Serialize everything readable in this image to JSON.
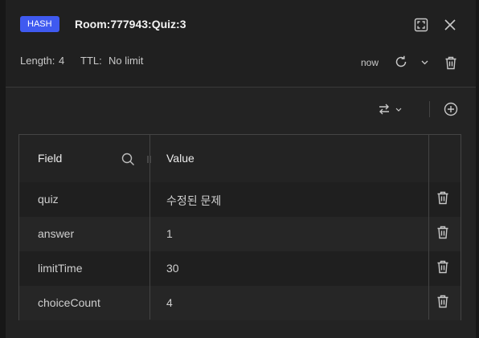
{
  "header": {
    "type_badge": "HASH",
    "key_name": "Room:777943:Quiz:3",
    "length_label": "Length:",
    "length_value": "4",
    "ttl_label": "TTL:",
    "ttl_value": "No limit",
    "refresh_label": "now"
  },
  "table": {
    "columns": [
      "Field",
      "Value"
    ],
    "rows": [
      {
        "field": "quiz",
        "value": "수정된 문제"
      },
      {
        "field": "answer",
        "value": "1"
      },
      {
        "field": "limitTime",
        "value": "30"
      },
      {
        "field": "choiceCount",
        "value": "4"
      }
    ]
  },
  "colors": {
    "badge": "#3f5af0",
    "background": "#232323"
  }
}
